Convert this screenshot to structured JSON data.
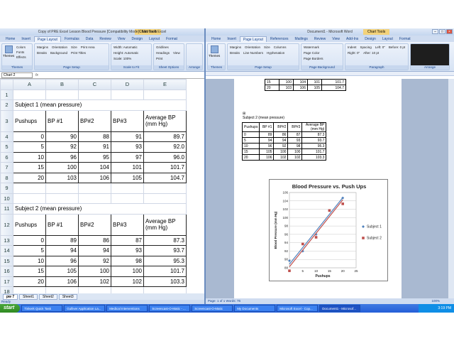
{
  "excel": {
    "title": "Copy of PRE Excel Lesson Blood Pressure [Compatibility Mode] - Microsoft Excel",
    "context_tab": "Chart Tools",
    "tabs": [
      "Home",
      "Insert",
      "Page Layout",
      "Formulas",
      "Data",
      "Review",
      "View",
      "Design",
      "Layout",
      "Format"
    ],
    "active_tab": "Page Layout",
    "ribbon": {
      "themes": {
        "big": "Themes",
        "items": [
          "Colors",
          "Fonts",
          "Effects"
        ],
        "label": "Themes"
      },
      "page_setup": {
        "items": [
          "Margins",
          "Orientation",
          "Size",
          "Print Area",
          "Breaks",
          "Background",
          "Print Titles"
        ],
        "label": "Page Setup"
      },
      "scale": {
        "items": [
          "Width:",
          "Height:",
          "Scale:"
        ],
        "values": [
          "Automatic",
          "Automatic",
          "100%"
        ],
        "label": "Scale to Fit"
      },
      "sheet_options": {
        "items": [
          "Gridlines",
          "Headings",
          "View",
          "Print"
        ],
        "label": "Sheet Options"
      },
      "arrange": {
        "label": "Arrange"
      }
    },
    "namebox": "Chart 2",
    "fx": "fx",
    "columns": [
      "A",
      "B",
      "C",
      "D",
      "E"
    ],
    "rows": [
      {
        "n": "1",
        "cells": [
          "",
          "",
          "",
          "",
          ""
        ]
      },
      {
        "n": "2",
        "cells": [
          "Subject 1 (mean pressure)",
          "",
          "",
          "",
          ""
        ]
      },
      {
        "n": "3",
        "cells": [
          "Pushups",
          "BP #1",
          "BP#2",
          "BP#3",
          "Average BP (mm Hg)"
        ]
      },
      {
        "n": "4",
        "cells": [
          "0",
          "90",
          "88",
          "91",
          "89.7"
        ]
      },
      {
        "n": "5",
        "cells": [
          "5",
          "92",
          "91",
          "93",
          "92.0"
        ]
      },
      {
        "n": "6",
        "cells": [
          "10",
          "96",
          "95",
          "97",
          "96.0"
        ]
      },
      {
        "n": "7",
        "cells": [
          "15",
          "100",
          "104",
          "101",
          "101.7"
        ]
      },
      {
        "n": "8",
        "cells": [
          "20",
          "103",
          "106",
          "105",
          "104.7"
        ]
      },
      {
        "n": "9",
        "cells": [
          "",
          "",
          "",
          "",
          ""
        ]
      },
      {
        "n": "10",
        "cells": [
          "",
          "",
          "",
          "",
          ""
        ]
      },
      {
        "n": "11",
        "cells": [
          "Subject 2 (mean pressure)",
          "",
          "",
          "",
          ""
        ]
      },
      {
        "n": "12",
        "cells": [
          "Pushups",
          "BP #1",
          "BP#2",
          "BP#3",
          "Average BP (mm Hg)"
        ]
      },
      {
        "n": "13",
        "cells": [
          "0",
          "89",
          "86",
          "87",
          "87.3"
        ]
      },
      {
        "n": "14",
        "cells": [
          "5",
          "94",
          "94",
          "93",
          "93.7"
        ]
      },
      {
        "n": "15",
        "cells": [
          "10",
          "96",
          "92",
          "98",
          "95.3"
        ]
      },
      {
        "n": "16",
        "cells": [
          "15",
          "105",
          "100",
          "100",
          "101.7"
        ]
      },
      {
        "n": "17",
        "cells": [
          "20",
          "106",
          "102",
          "102",
          "103.3"
        ]
      },
      {
        "n": "18",
        "cells": [
          "",
          "",
          "",
          "",
          ""
        ]
      },
      {
        "n": "19",
        "cells": [
          "",
          "",
          "",
          "",
          ""
        ]
      }
    ],
    "sheet_tabs": [
      "pw 7",
      "Sheet1",
      "Sheet2",
      "Sheet3"
    ],
    "status": "Ready"
  },
  "word": {
    "title": "Document1 - Microsoft Word",
    "context_tab": "Chart Tools",
    "tabs": [
      "Home",
      "Insert",
      "Page Layout",
      "References",
      "Mailings",
      "Review",
      "View",
      "Add-Ins",
      "Design",
      "Layout",
      "Format"
    ],
    "active_tab": "Page Layout",
    "ribbon": {
      "themes": {
        "big": "Themes",
        "label": "Themes"
      },
      "page_setup": {
        "items": [
          "Margins",
          "Orientation",
          "Size",
          "Columns",
          "Breaks",
          "Line Numbers",
          "Hyphenation"
        ],
        "label": "Page Setup"
      },
      "bg": {
        "items": [
          "Watermark",
          "Page Color",
          "Page Borders"
        ],
        "label": "Page Background"
      },
      "para": {
        "items": [
          "Indent",
          "Left: 0\"",
          "Right: 0\"",
          "Spacing",
          "Before: 0 pt",
          "After: 10 pt"
        ],
        "label": "Paragraph"
      },
      "arrange": {
        "label": "Arrange"
      }
    },
    "table1_rows": [
      [
        "15",
        "100",
        "104",
        "101",
        "101.7"
      ],
      [
        "20",
        "103",
        "106",
        "105",
        "104.7"
      ]
    ],
    "subject2_label": "Subject 2 (mean pressure)",
    "table2_header": [
      "Pushups",
      "BP #1",
      "BP#2",
      "BP#3",
      "Average BP (mm Hg)"
    ],
    "table2_rows": [
      [
        "0",
        "89",
        "86",
        "87",
        "87.3"
      ],
      [
        "5",
        "94",
        "94",
        "93",
        "93.7"
      ],
      [
        "10",
        "96",
        "92",
        "98",
        "95.3"
      ],
      [
        "15",
        "105",
        "100",
        "100",
        "101.7"
      ],
      [
        "20",
        "106",
        "102",
        "102",
        "103.3"
      ]
    ],
    "status": "Page: 1 of 1    Words: 76",
    "zoom": "100%"
  },
  "chart_data": {
    "type": "scatter",
    "title": "Blood Pressure vs. Push Ups",
    "xlabel": "Pushups",
    "ylabel": "Blood Pressure (mm Hg)",
    "xlim": [
      0,
      25
    ],
    "ylim": [
      88,
      106
    ],
    "xticks": [
      0,
      5,
      10,
      15,
      20,
      25
    ],
    "yticks": [
      88,
      90,
      92,
      94,
      96,
      98,
      100,
      102,
      104,
      106
    ],
    "trendlines": true,
    "legend_position": "right",
    "series": [
      {
        "name": "Subject 1",
        "color": "#4f81bd",
        "x": [
          0,
          5,
          10,
          15,
          20
        ],
        "y": [
          89.7,
          92.0,
          96.0,
          101.7,
          104.7
        ]
      },
      {
        "name": "Subject 2",
        "color": "#c0504d",
        "x": [
          0,
          5,
          10,
          15,
          20
        ],
        "y": [
          87.3,
          93.7,
          95.3,
          101.7,
          103.3
        ]
      }
    ]
  },
  "taskbar": {
    "start": "start",
    "tasks": [
      "Tinkerk Quick Task",
      "Gulliver Application La...",
      "Medical Interventions",
      "Screencast-O-Matic - ...",
      "Screencast-O-Matic",
      "My Documents",
      "Microsoft Excel - Cop...",
      "Document1 - Microsof..."
    ],
    "clock": "3:19 PM"
  }
}
